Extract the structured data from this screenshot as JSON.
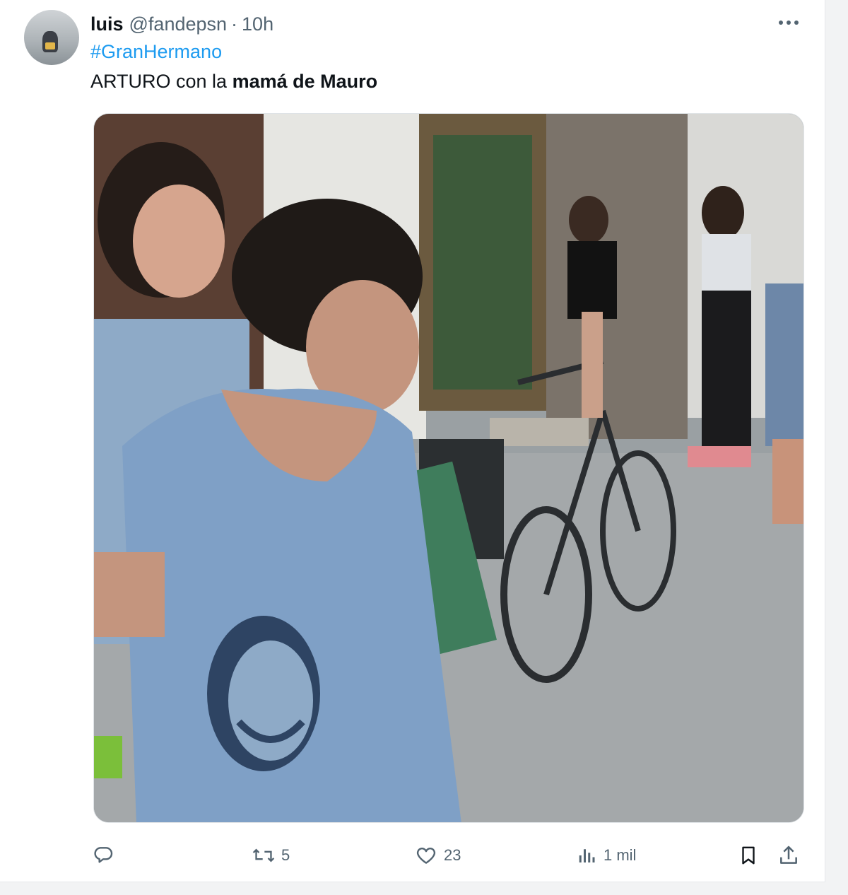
{
  "tweet": {
    "author_name": "luis",
    "handle": "@fandepsn",
    "separator": "·",
    "time": "10h",
    "hashtag": "#GranHermano",
    "text_normal": "ARTURO con la ",
    "text_bold": "mamá de Mauro"
  },
  "media": {
    "description_icon": "photo"
  },
  "actions": {
    "reply_count": "",
    "retweet_count": "5",
    "like_count": "23",
    "views_count": "1 mil"
  },
  "icons": {
    "more": "more-horizontal-icon",
    "reply": "reply-icon",
    "retweet": "retweet-icon",
    "like": "heart-icon",
    "views": "views-chart-icon",
    "bookmark": "bookmark-icon",
    "share": "share-icon"
  },
  "colors": {
    "link": "#1d9bf0",
    "secondary_text": "#536471",
    "primary_text": "#0f1419"
  }
}
